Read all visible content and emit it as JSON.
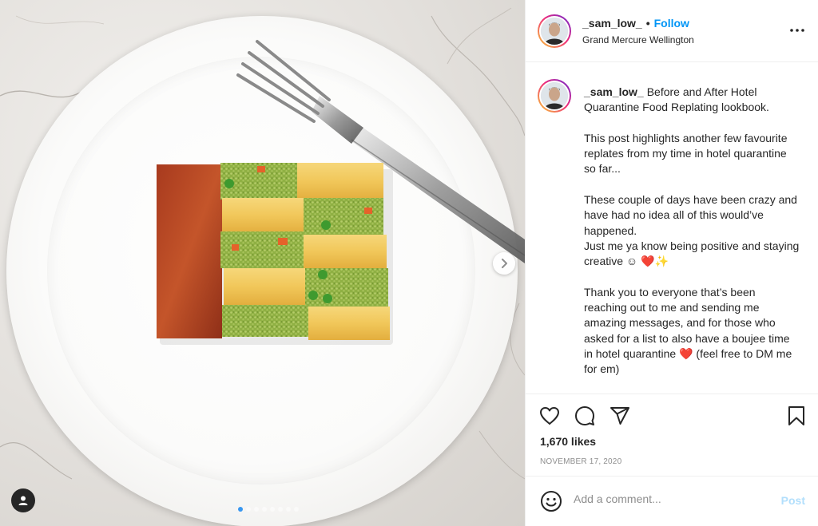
{
  "post": {
    "username": "_sam_low_",
    "follow_label": "Follow",
    "separator": "•",
    "location": "Grand Mercure Wellington",
    "more_icon": "more-horizontal-icon"
  },
  "caption": {
    "username": "_sam_low_",
    "paragraphs": [
      "Before and After Hotel Quarantine Food Replating lookbook.",
      "This post highlights another few favourite replates from my time in hotel quarantine so far...",
      "These couple of days have been crazy and have had no idea all of this would’ve happened.",
      "Just me ya know being positive and staying creative ☺",
      "Thank you to everyone that’s been reaching out to me and sending me amazing messages, and for those who asked for a list to also have a boujee time in hotel quarantine",
      "(feel free to DM me for em)"
    ],
    "emoji_heart": "❤️",
    "emoji_sparkles": "✨"
  },
  "actions": {
    "like_icon": "heart-icon",
    "comment_icon": "comment-icon",
    "share_icon": "share-icon",
    "save_icon": "bookmark-icon"
  },
  "likes_text": "1,670 likes",
  "date_text": "NOVEMBER 17, 2020",
  "comment": {
    "placeholder": "Add a comment...",
    "post_label": "Post",
    "emoji_icon": "smiley-icon"
  },
  "carousel": {
    "slide_count": 8,
    "active_index": 0
  },
  "colors": {
    "follow_blue": "#0095f6",
    "post_disabled": "#b2dffc",
    "heart_red": "#e0245e"
  }
}
